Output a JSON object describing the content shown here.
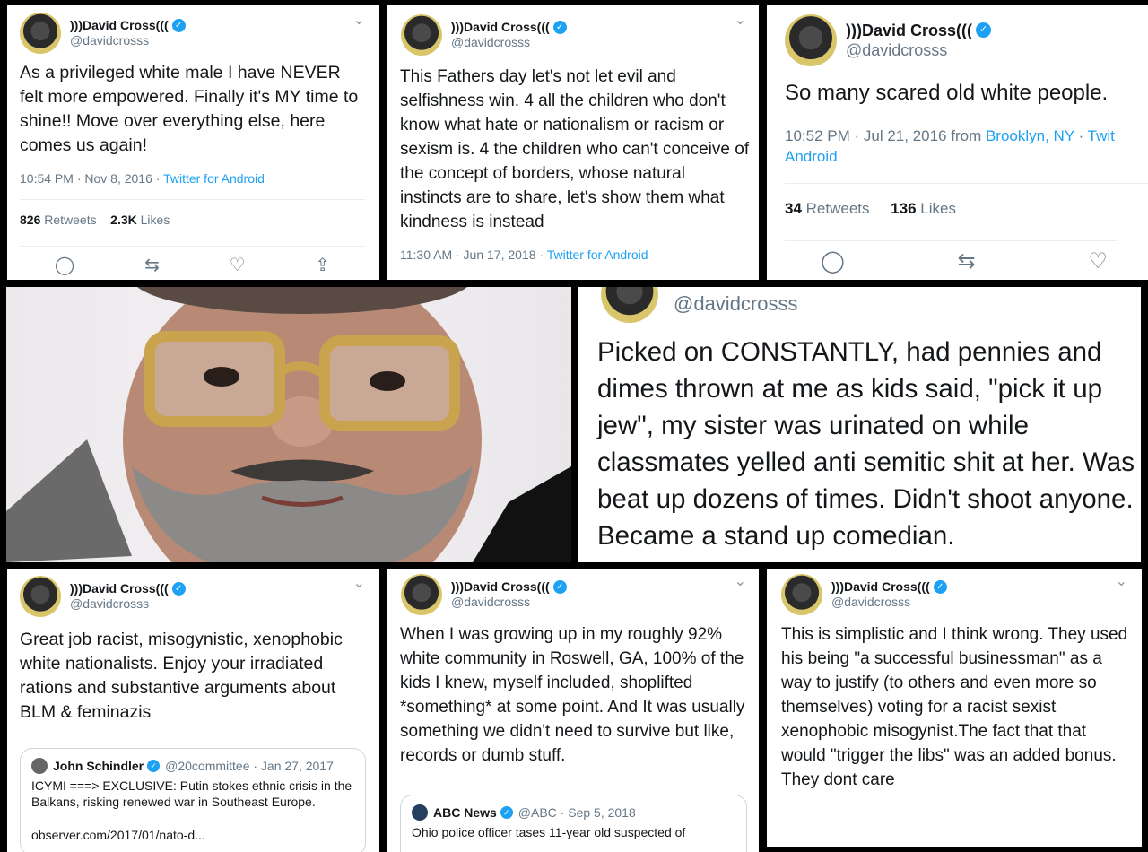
{
  "tweets": [
    {
      "name": ")))David Cross(((",
      "handle": "@davidcrosss",
      "text": "As a privileged white male I have NEVER felt more empowered. Finally it's MY time to shine!! Move over everything else, here comes us again!",
      "time": "10:54 PM · Nov 8, 2016 · ",
      "source": "Twitter for Android",
      "retweets": "826",
      "retweets_label": "Retweets",
      "likes": "2.3K",
      "likes_label": "Likes"
    },
    {
      "name": ")))David Cross(((",
      "handle": "@davidcrosss",
      "text": "This Fathers day let's not let evil and selfishness win. 4 all the children who don't know what hate or nationalism or racism or sexism is. 4 the children who can't conceive of the concept of borders, whose natural instincts are to share, let's show them what kindness is instead",
      "time": "11:30 AM · Jun 17, 2018 · ",
      "source": "Twitter for Android"
    },
    {
      "name": ")))David Cross(((",
      "handle": "@davidcrosss",
      "text": "So many scared old white people.",
      "time": "10:52 PM · Jul 21, 2016 from ",
      "location": "Brooklyn, NY",
      "sep": " · ",
      "source_a": "Twit",
      "source_b": "Android",
      "retweets": "34",
      "retweets_label": "Retweets",
      "likes": "136",
      "likes_label": "Likes"
    },
    {
      "handle": "@davidcrosss",
      "text": "Picked on CONSTANTLY, had pennies and dimes thrown at me as kids said, \"pick it up jew\", my sister was urinated on while classmates yelled anti semitic shit at her. Was beat up dozens of times. Didn't shoot anyone. Became a stand up comedian."
    },
    {
      "name": ")))David Cross(((",
      "handle": "@davidcrosss",
      "text": "Great job racist, misogynistic, xenophobic white nationalists. Enjoy your irradiated rations and substantive arguments about BLM & feminazis",
      "quote": {
        "name": "John Schindler",
        "meta": "@20committee · Jan 27, 2017",
        "text": "ICYMI ===> EXCLUSIVE: Putin stokes ethnic crisis in the Balkans, risking renewed war in Southeast Europe.",
        "link": "observer.com/2017/01/nato-d..."
      }
    },
    {
      "name": ")))David Cross(((",
      "handle": "@davidcrosss",
      "text": "When I was growing up in my roughly 92% white community in Roswell, GA, 100% of the kids I knew, myself included, shoplifted *something* at some point. And It was usually something we didn't need to survive but like, records or dumb stuff.",
      "quote": {
        "name": "ABC News",
        "meta": "@ABC · Sep 5, 2018",
        "text": "Ohio police officer tases 11-year old suspected of"
      }
    },
    {
      "name": ")))David Cross(((",
      "handle": "@davidcrosss",
      "text": "This is simplistic and I think wrong. They used his being \"a successful businessman\" as a way to justify (to others and even more so themselves) voting for a racist sexist xenophobic misogynist.The fact that that would \"trigger the libs\" was an added bonus. They dont care"
    }
  ],
  "icons": {
    "verified": "✓",
    "chevron": "⌄",
    "reply": "◯",
    "retweet": "⇆",
    "like": "♡",
    "share": "⇪"
  },
  "colors": {
    "link": "#1da1f2",
    "muted": "#657786",
    "background": "#000000"
  }
}
